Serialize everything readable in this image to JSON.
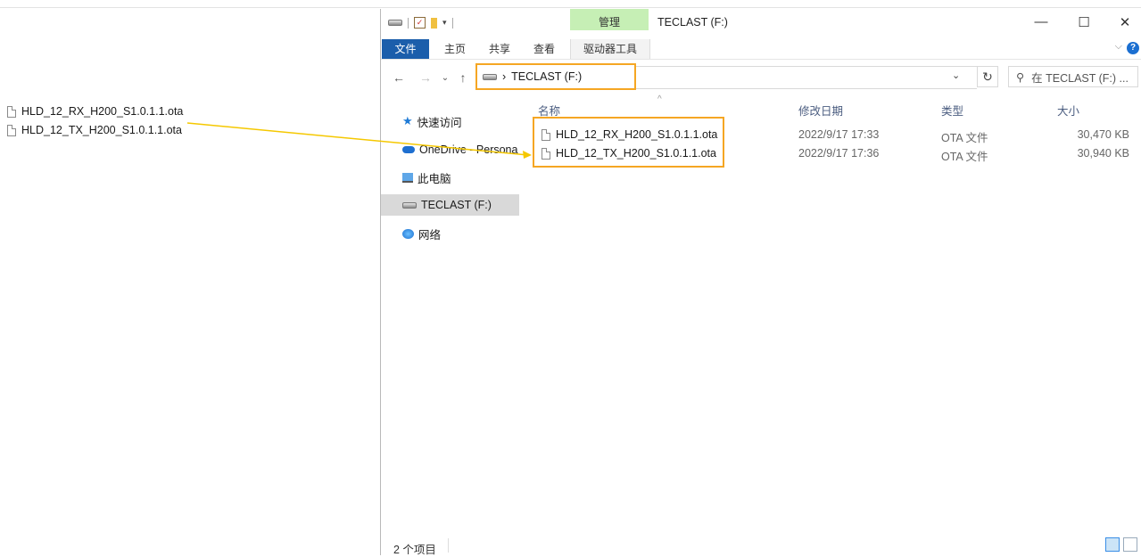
{
  "desktop": {
    "files": [
      {
        "name": "HLD_12_RX_H200_S1.0.1.1.ota"
      },
      {
        "name": "HLD_12_TX_H200_S1.0.1.1.ota"
      }
    ]
  },
  "window": {
    "context_tab": "管理",
    "title": "TECLAST (F:)",
    "controls": {
      "minimize": "—",
      "maximize": "☐",
      "close": "✕"
    }
  },
  "ribbon": {
    "tabs": [
      "文件",
      "主页",
      "共享",
      "查看",
      "驱动器工具"
    ],
    "help": "?"
  },
  "address": {
    "path": "TECLAST (F:)",
    "search_placeholder": "在 TECLAST (F:) ..."
  },
  "nav": {
    "items": [
      {
        "label": "快速访问"
      },
      {
        "label": "OneDrive - Persona"
      },
      {
        "label": "此电脑"
      },
      {
        "label": "TECLAST (F:)"
      },
      {
        "label": "网络"
      }
    ]
  },
  "columns": {
    "name": "名称",
    "date": "修改日期",
    "type": "类型",
    "size": "大小"
  },
  "files": [
    {
      "name": "HLD_12_RX_H200_S1.0.1.1.ota",
      "date": "2022/9/17 17:33",
      "type": "OTA 文件",
      "size": "30,470 KB"
    },
    {
      "name": "HLD_12_TX_H200_S1.0.1.1.ota",
      "date": "2022/9/17 17:36",
      "type": "OTA 文件",
      "size": "30,940 KB"
    }
  ],
  "status": {
    "count": "2 个项目"
  },
  "colors": {
    "highlight": "#f5a623",
    "arrow": "#f5c800",
    "file_tab": "#1b5eab",
    "manage_tab": "#c6efb5"
  }
}
